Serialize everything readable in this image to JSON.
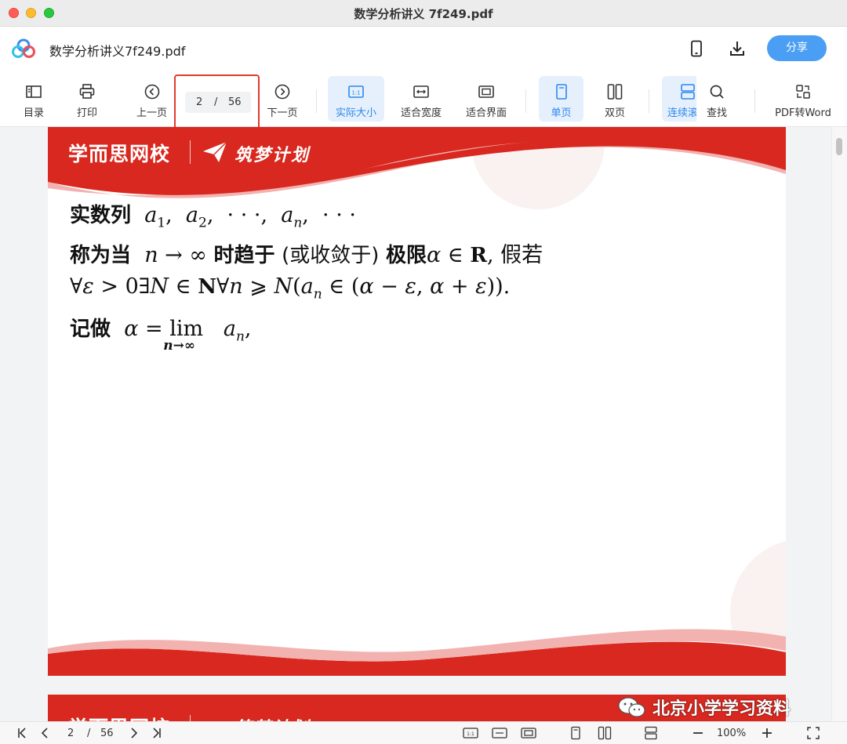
{
  "window": {
    "title": "数学分析讲义 7f249.pdf"
  },
  "header": {
    "doc_name": "数学分析讲义7f249.pdf",
    "share_label": "分享"
  },
  "toolbar": {
    "toc": "目录",
    "print": "打印",
    "prev": "上一页",
    "current_page": "2",
    "separator": "/",
    "total_pages": "56",
    "next": "下一页",
    "actual_size": "实际大小",
    "fit_width": "适合宽度",
    "fit_page": "适合界面",
    "single_page": "单页",
    "double_page": "双页",
    "continuous": "连续滚",
    "find": "查找",
    "pdf_to_word": "PDF转Word"
  },
  "document": {
    "banner_brand": "学而思网校",
    "banner_slogan": "筑梦计划",
    "line1_text": "实数列",
    "line2_text_a": "称为当",
    "line2_text_b": "时趋于",
    "line2_text_c": "(或收敛于)",
    "line2_text_d": "极限",
    "line2_text_e": ", 假若",
    "line4_text": "记做",
    "line4_lim": "lim",
    "line4_lim_sub": "n→∞"
  },
  "bottombar": {
    "current_page": "2",
    "separator": "/",
    "total_pages": "56",
    "zoom": "100%"
  },
  "watermark": {
    "text": "北京小学学习资料"
  },
  "colors": {
    "accent": "#4a9ef4",
    "banner_red": "#d8281f",
    "highlight": "#e23a2e"
  }
}
